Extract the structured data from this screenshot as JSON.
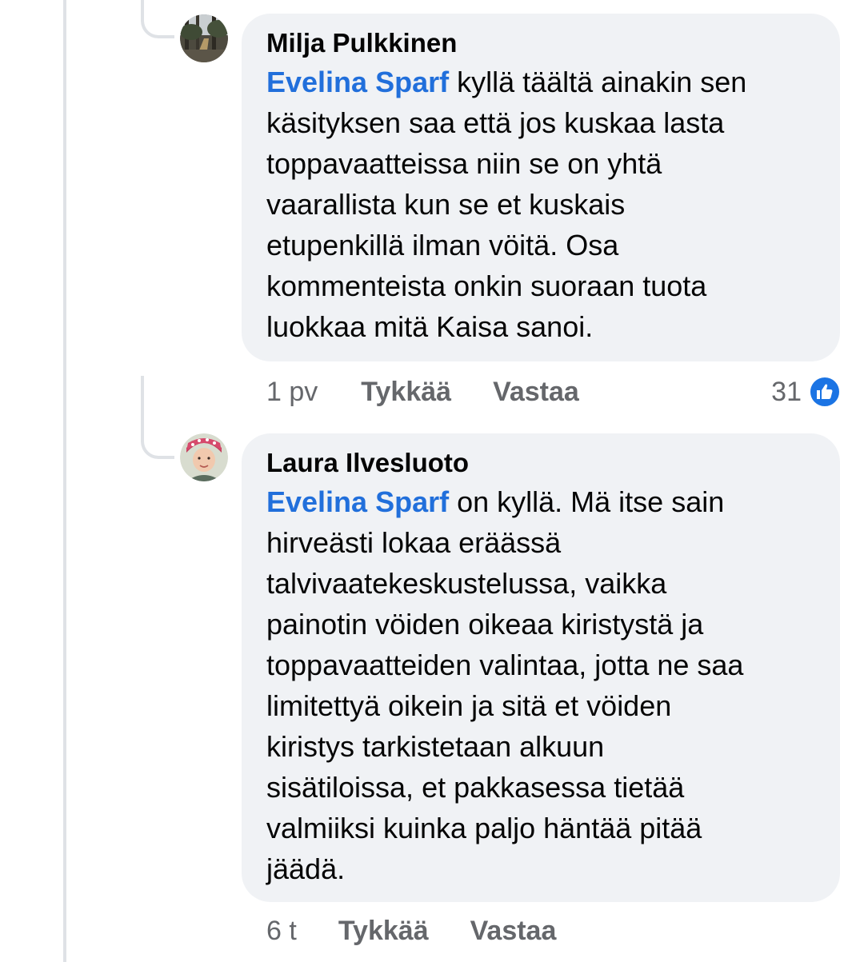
{
  "comments": [
    {
      "author": "Milja Pulkkinen",
      "mention": "Evelina Sparf",
      "text": " kyllä täältä ainakin sen\nkäsityksen saa että jos kuskaa lasta\ntoppavaatteissa niin se on yhtä\nvaarallista kun se et kuskais\netupenkillä ilman vöitä. Osa\nkommenteista onkin suoraan tuota\nluokkaa mitä Kaisa sanoi.",
      "time": "1 pv",
      "like_label": "Tykkää",
      "reply_label": "Vastaa",
      "reaction_count": "31",
      "reaction_icon": "like-icon",
      "reaction_color": "#1b74e4"
    },
    {
      "author": "Laura Ilvesluoto",
      "mention": "Evelina Sparf",
      "text": " on kyllä. Mä itse sain\nhirveästi lokaa eräässä\ntalvivaatekeskustelussa, vaikka\npainotin vöiden oikeaa kiristystä ja\ntoppavaatteiden valintaa, jotta ne saa\nlimitettyä oikein ja sitä et vöiden\nkiristys tarkistetaan alkuun\nsisätiloissa, et pakkasessa tietää\nvalmiiksi kuinka paljo häntää pitää\njäädä.",
      "time": "6 t",
      "like_label": "Tykkää",
      "reply_label": "Vastaa"
    }
  ],
  "colors": {
    "mention": "#216fdb",
    "bubble_bg": "#f0f2f5",
    "meta_text": "#65676b",
    "thread_line": "#dfe2e6"
  }
}
